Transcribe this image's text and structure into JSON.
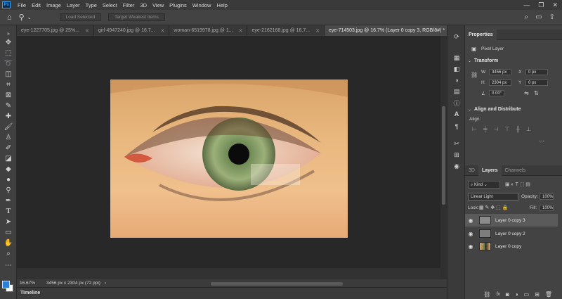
{
  "menu": {
    "logo": "Ps",
    "items": [
      "File",
      "Edit",
      "Image",
      "Layer",
      "Type",
      "Select",
      "Filter",
      "3D",
      "View",
      "Plugins",
      "Window",
      "Help"
    ],
    "window_controls": [
      "—",
      "❐",
      "✕"
    ]
  },
  "options_bar": {
    "load_selected": "Load Selected",
    "target_icons": "Target Weakest Items"
  },
  "tabs": [
    {
      "label": "eye-1227705.jpg @ 25%..."
    },
    {
      "label": "girl-4947240.jpg @ 16.7..."
    },
    {
      "label": "woman-6519978.jpg @ 1..."
    },
    {
      "label": "eye-2162168.jpg @ 16.7..."
    },
    {
      "label": "eye-714503.jpg @ 16.7% (Layer 0 copy 3, RGB/8#) *",
      "active": true
    }
  ],
  "status": {
    "zoom": "16.67%",
    "doc_info": "3456 px x 2304 px (72 ppi)"
  },
  "timeline_label": "Timeline",
  "properties": {
    "tab": "Properties",
    "layer_type": "Pixel Layer",
    "transform_title": "Transform",
    "w_label": "W",
    "w_value": "3456 px",
    "h_label": "H",
    "h_value": "2304 px",
    "x_label": "X",
    "x_value": "0 px",
    "y_label": "Y",
    "y_value": "0 px",
    "angle_value": "0.00°",
    "align_title": "Align and Distribute",
    "align_label": "Align:"
  },
  "layers_panel": {
    "tabs": [
      "3D",
      "Layers",
      "Channels"
    ],
    "active_tab": "Layers",
    "filter_kind": "Kind",
    "blend_mode": "Linear Light",
    "opacity_label": "Opacity:",
    "opacity_value": "100%",
    "lock_label": "Lock:",
    "fill_label": "Fill:",
    "fill_value": "100%",
    "layers": [
      {
        "name": "Layer 0 copy 3",
        "selected": true
      },
      {
        "name": "Layer 0 copy 2",
        "selected": false
      },
      {
        "name": "Layer 0 copy",
        "selected": false
      }
    ]
  },
  "colors": {
    "foreground": "#2b7fd6",
    "background": "#ffffff",
    "accent": "#31a8ff"
  }
}
